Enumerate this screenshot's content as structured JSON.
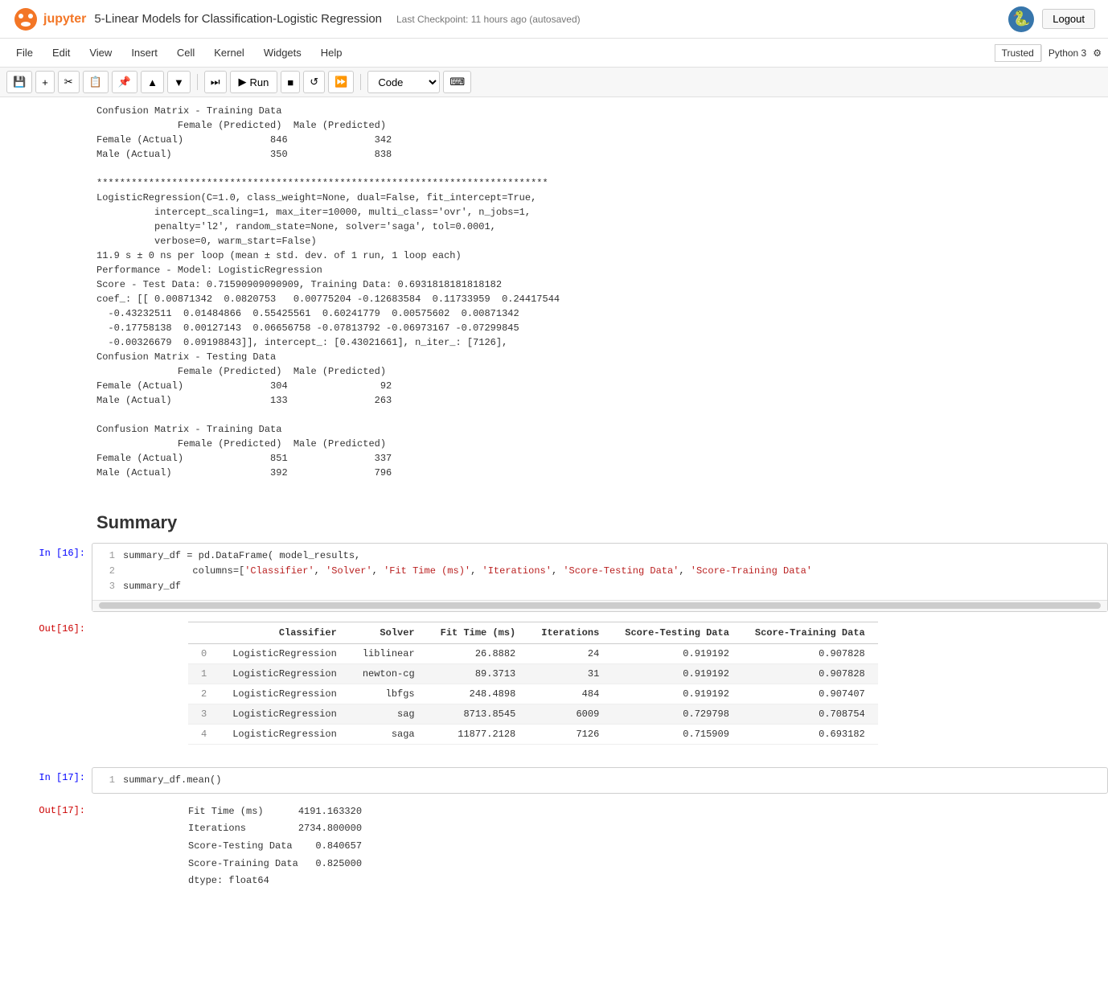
{
  "header": {
    "title": "5-Linear Models for Classification-Logistic Regression",
    "checkpoint_label": "Last Checkpoint:",
    "checkpoint_time": "11 hours ago",
    "checkpoint_note": "(autosaved)",
    "logout_label": "Logout",
    "trusted_label": "Trusted",
    "kernel_label": "Python 3"
  },
  "menubar": {
    "items": [
      "File",
      "Edit",
      "View",
      "Insert",
      "Cell",
      "Kernel",
      "Widgets",
      "Help"
    ]
  },
  "toolbar": {
    "run_label": "Run",
    "cell_type": "Code"
  },
  "output_text_1": "Confusion Matrix - Training Data\n              Female (Predicted)  Male (Predicted)\nFemale (Actual)               846               342\nMale (Actual)                 350               838\n\n******************************************************************************\nLogisticRegression(C=1.0, class_weight=None, dual=False, fit_intercept=True,\n          intercept_scaling=1, max_iter=10000, multi_class='ovr', n_jobs=1,\n          penalty='l2', random_state=None, solver='saga', tol=0.0001,\n          verbose=0, warm_start=False)\n11.9 s ± 0 ns per loop (mean ± std. dev. of 1 run, 1 loop each)\nPerformance - Model: LogisticRegression\nScore - Test Data: 0.71590909090909, Training Data: 0.6931818181818182\ncoef_: [[ 0.00871342  0.0820753   0.00775204 -0.12683584  0.11733959  0.24417544\n  -0.43232511  0.01484866  0.55425561  0.60241779  0.00575602  0.00871342\n  -0.17758138  0.00127143  0.06656758 -0.07813792 -0.06973167 -0.07299845\n  -0.00326679  0.09198843]], intercept_: [0.43021661], n_iter_: [7126],\nConfusion Matrix - Testing Data\n              Female (Predicted)  Male (Predicted)\nFemale (Actual)               304                92\nMale (Actual)                 133               263\n\nConfusion Matrix - Training Data\n              Female (Predicted)  Male (Predicted)\nFemale (Actual)               851               337\nMale (Actual)                 392               796",
  "summary_heading": "Summary",
  "cell_in16": {
    "prompt": "In [16]:",
    "lines": [
      "summary_df = pd.DataFrame( model_results,",
      "            columns=['Classifier', 'Solver', 'Fit Time (ms)', 'Iterations', 'Score-Testing Data', 'Score-Training Data'",
      "summary_df"
    ]
  },
  "cell_out16": {
    "prompt": "Out[16]:",
    "table": {
      "headers": [
        "",
        "Classifier",
        "Solver",
        "Fit Time (ms)",
        "Iterations",
        "Score-Testing Data",
        "Score-Training Data"
      ],
      "rows": [
        [
          "0",
          "LogisticRegression",
          "liblinear",
          "26.8882",
          "24",
          "0.919192",
          "0.907828"
        ],
        [
          "1",
          "LogisticRegression",
          "newton-cg",
          "89.3713",
          "31",
          "0.919192",
          "0.907828"
        ],
        [
          "2",
          "LogisticRegression",
          "lbfgs",
          "248.4898",
          "484",
          "0.919192",
          "0.907407"
        ],
        [
          "3",
          "LogisticRegression",
          "sag",
          "8713.8545",
          "6009",
          "0.729798",
          "0.708754"
        ],
        [
          "4",
          "LogisticRegression",
          "saga",
          "11877.2128",
          "7126",
          "0.715909",
          "0.693182"
        ]
      ]
    }
  },
  "cell_in17": {
    "prompt": "In [17]:",
    "line": "summary_df.mean()"
  },
  "cell_out17": {
    "prompt": "Out[17]:",
    "lines": [
      "Fit Time (ms)      4191.163320",
      "Iterations         2734.800000",
      "Score-Testing Data    0.840657",
      "Score-Training Data   0.825000",
      "dtype: float64"
    ]
  }
}
